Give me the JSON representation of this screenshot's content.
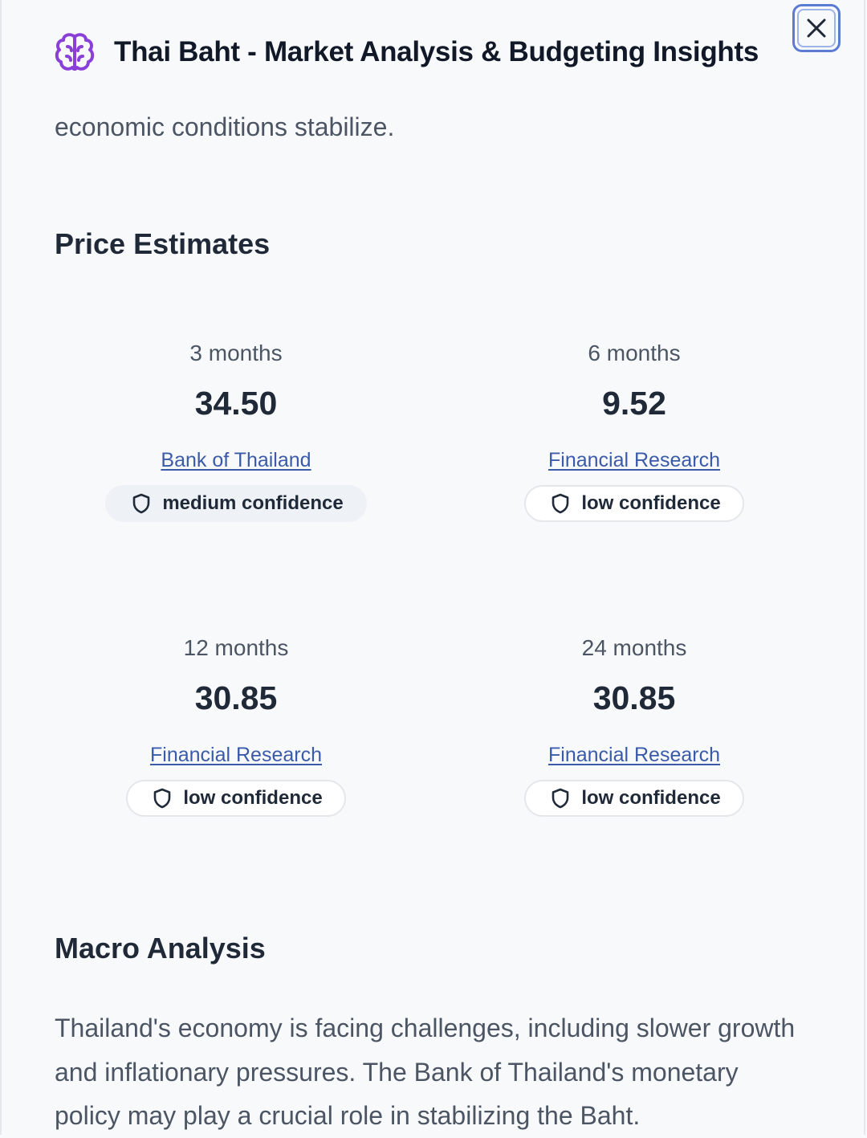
{
  "header": {
    "title": "Thai Baht - Market Analysis & Budgeting Insights",
    "icon": "brain-icon",
    "accent_color": "#8b3fd9"
  },
  "close_button": {
    "icon": "close-icon"
  },
  "lead_text": "economic conditions stabilize.",
  "price_estimates": {
    "title": "Price Estimates",
    "items": [
      {
        "period": "3 months",
        "value": "34.50",
        "source": "Bank of Thailand",
        "confidence": "medium confidence"
      },
      {
        "period": "6 months",
        "value": "9.52",
        "source": "Financial Research",
        "confidence": "low confidence"
      },
      {
        "period": "12 months",
        "value": "30.85",
        "source": "Financial Research",
        "confidence": "low confidence"
      },
      {
        "period": "24 months",
        "value": "30.85",
        "source": "Financial Research",
        "confidence": "low confidence"
      }
    ]
  },
  "macro_analysis": {
    "title": "Macro Analysis",
    "text": "Thailand's economy is facing challenges, including slower growth and inflationary pressures. The Bank of Thailand's monetary policy may play a crucial role in stabilizing the Baht."
  }
}
